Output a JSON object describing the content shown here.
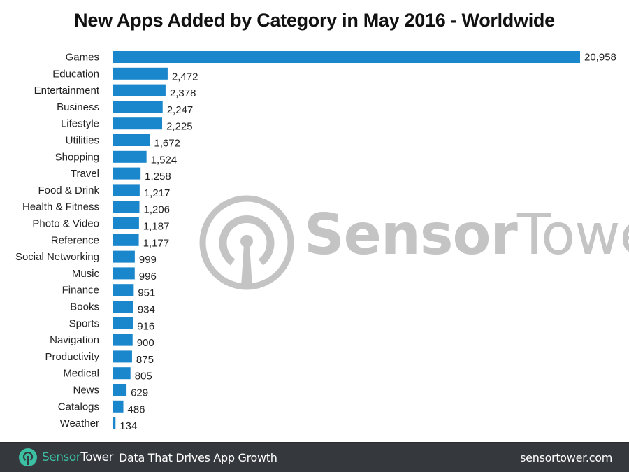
{
  "chart_data": {
    "type": "bar",
    "orientation": "horizontal",
    "title": "New Apps Added by Category in May 2016 - Worldwide",
    "xlabel": "",
    "ylabel": "",
    "grid": false,
    "legend": "none",
    "xlim": [
      0,
      20958
    ],
    "categories": [
      "Games",
      "Education",
      "Entertainment",
      "Business",
      "Lifestyle",
      "Utilities",
      "Shopping",
      "Travel",
      "Food & Drink",
      "Health & Fitness",
      "Photo & Video",
      "Reference",
      "Social Networking",
      "Music",
      "Finance",
      "Books",
      "Sports",
      "Navigation",
      "Productivity",
      "Medical",
      "News",
      "Catalogs",
      "Weather"
    ],
    "values": [
      20958,
      2472,
      2378,
      2247,
      2225,
      1672,
      1524,
      1258,
      1217,
      1206,
      1187,
      1177,
      999,
      996,
      951,
      934,
      916,
      900,
      875,
      805,
      629,
      486,
      134
    ],
    "value_labels": [
      "20,958",
      "2,472",
      "2,378",
      "2,247",
      "2,225",
      "1,672",
      "1,524",
      "1,258",
      "1,217",
      "1,206",
      "1,187",
      "1,177",
      "999",
      "996",
      "951",
      "934",
      "916",
      "900",
      "875",
      "805",
      "629",
      "486",
      "134"
    ],
    "bar_color": "#1a86cc"
  },
  "watermark": {
    "text_bold": "Sensor",
    "text_light": "Tower",
    "icon": "sensortower-logo-icon",
    "color": "#c4c4c4"
  },
  "footer": {
    "brand_accent": "Sensor",
    "brand_rest": "Tower",
    "tagline": "Data That Drives App Growth",
    "website": "sensortower.com",
    "icon": "sensortower-logo-icon",
    "accent_color": "#3cc0a3",
    "background": "#35383d"
  }
}
